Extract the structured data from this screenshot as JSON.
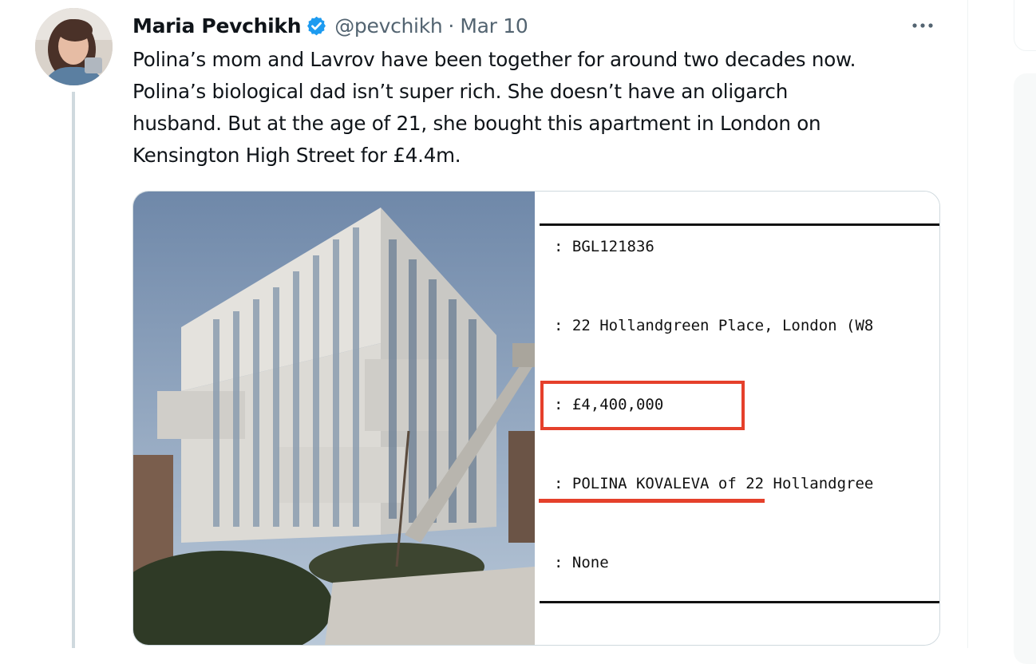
{
  "tweet": {
    "author_name": "Maria Pevchikh",
    "handle": "@pevchikh",
    "separator": "·",
    "date": "Mar 10",
    "text_lines": [
      "Polina’s mom and Lavrov have been together for around two decades now.",
      "Polina’s biological dad isn’t super rich. She doesn’t have an oligarch",
      "husband. But at the age of 21, she bought this apartment in London on",
      "Kensington High Street for £4.4m."
    ]
  },
  "media": {
    "document": {
      "title_number": ": BGL121836",
      "address": ": 22 Hollandgreen Place, London (W8",
      "price": ": £4,400,000",
      "owner": ": POLINA KOVALEVA of 22 Hollandgree",
      "restriction": ": None"
    },
    "highlight_color": "#e5402b"
  },
  "icons": {
    "verified": "verified-badge-icon",
    "more": "more-options-icon"
  },
  "colors": {
    "verified_blue": "#1d9bf0",
    "secondary_text": "#536471",
    "thread_line": "#cfd9de"
  }
}
